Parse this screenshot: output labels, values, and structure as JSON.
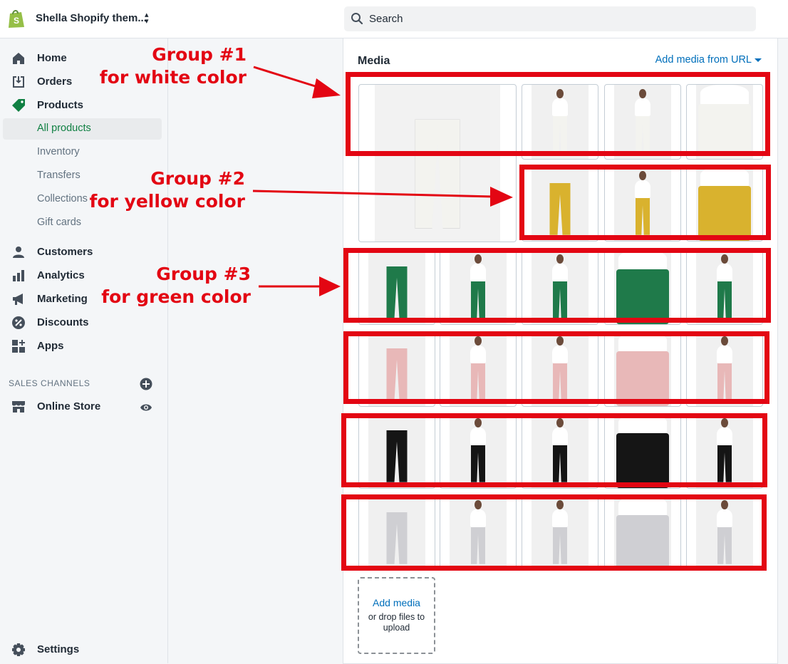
{
  "topbar": {
    "store_name": "Shella Shopify them...",
    "search_placeholder": "Search",
    "logo_icon": "shopify-bag-icon"
  },
  "sidebar": {
    "items": [
      {
        "label": "Home",
        "icon": "home-icon"
      },
      {
        "label": "Orders",
        "icon": "orders-icon"
      },
      {
        "label": "Products",
        "icon": "tag-icon"
      },
      {
        "label": "Customers",
        "icon": "person-icon"
      },
      {
        "label": "Analytics",
        "icon": "bar-chart-icon"
      },
      {
        "label": "Marketing",
        "icon": "megaphone-icon"
      },
      {
        "label": "Discounts",
        "icon": "discount-icon"
      },
      {
        "label": "Apps",
        "icon": "apps-icon"
      }
    ],
    "product_subitems": [
      {
        "label": "All products",
        "active": true
      },
      {
        "label": "Inventory",
        "active": false
      },
      {
        "label": "Transfers",
        "active": false
      },
      {
        "label": "Collections",
        "active": false
      },
      {
        "label": "Gift cards",
        "active": false
      }
    ],
    "channels_title": "SALES CHANNELS",
    "online_store": "Online Store",
    "settings": "Settings",
    "accent_color": "#108043"
  },
  "media": {
    "title": "Media",
    "add_from_url": "Add media from URL",
    "add_media_link": "Add media",
    "add_media_hint": "or drop files to upload",
    "colors": {
      "white": "#f3f3ef",
      "yellow": "#d9b22e",
      "green": "#1f7a4a",
      "pink": "#e8b8b8",
      "black": "#151515",
      "grey": "#cfcfd3"
    }
  },
  "annotations": {
    "group1_title": "Group #1",
    "group1_sub": "for white color",
    "group2_title": "Group #2",
    "group2_sub": "for yellow color",
    "group3_title": "Group #3",
    "group3_sub": "for green color",
    "highlight_color": "#e30613"
  }
}
